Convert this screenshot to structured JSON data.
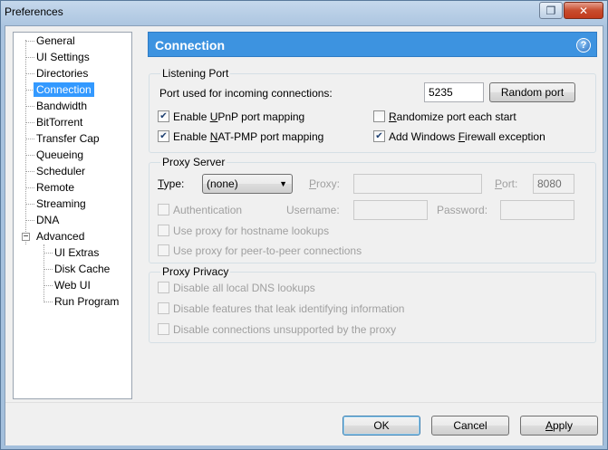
{
  "window": {
    "title": "Preferences",
    "restore_glyph": "❐",
    "close_glyph": "✕"
  },
  "tree": {
    "items": [
      {
        "label": "General"
      },
      {
        "label": "UI Settings"
      },
      {
        "label": "Directories"
      },
      {
        "label": "Connection",
        "selected": true
      },
      {
        "label": "Bandwidth"
      },
      {
        "label": "BitTorrent"
      },
      {
        "label": "Transfer Cap"
      },
      {
        "label": "Queueing"
      },
      {
        "label": "Scheduler"
      },
      {
        "label": "Remote"
      },
      {
        "label": "Streaming"
      },
      {
        "label": "DNA"
      },
      {
        "label": "Advanced",
        "expander": "−"
      },
      {
        "label": "UI Extras"
      },
      {
        "label": "Disk Cache"
      },
      {
        "label": "Web UI"
      },
      {
        "label": "Run Program"
      }
    ]
  },
  "panel": {
    "title": "Connection",
    "help_glyph": "?",
    "listening": {
      "group_label": "Listening Port",
      "port_label": "Port used for incoming connections:",
      "port_value": "5235",
      "random_button": "Random port",
      "upnp": {
        "pre": "Enable ",
        "key": "U",
        "post": "PnP port mapping",
        "checked": true
      },
      "natpmp": {
        "pre": "Enable ",
        "key": "N",
        "post": "AT-PMP port mapping",
        "checked": true
      },
      "randomize": {
        "pre": "",
        "key": "R",
        "post": "andomize port each start",
        "checked": false
      },
      "firewall": {
        "pre": "Add Windows ",
        "key": "F",
        "post": "irewall exception",
        "checked": true
      }
    },
    "proxy": {
      "group_label": "Proxy Server",
      "type_label_key": "T",
      "type_label_rest": "ype:",
      "type_value": "(none)",
      "proxy_label_key": "P",
      "proxy_label_rest": "roxy:",
      "proxy_value": "",
      "port_label_key": "P",
      "port_label_rest": "ort:",
      "port_value": "8080",
      "auth_label": "Authentication",
      "username_label": "Username:",
      "username_value": "",
      "password_label": "Password:",
      "password_value": "",
      "hostname_label": "Use proxy for hostname lookups",
      "p2p_label": "Use proxy for peer-to-peer connections"
    },
    "privacy": {
      "group_label": "Proxy Privacy",
      "dns_label": "Disable all local DNS lookups",
      "leak_label": "Disable features that leak identifying information",
      "unsupported_label": "Disable connections unsupported by the proxy"
    }
  },
  "footer": {
    "ok": "OK",
    "cancel": "Cancel",
    "apply_key": "A",
    "apply_rest": "pply"
  }
}
